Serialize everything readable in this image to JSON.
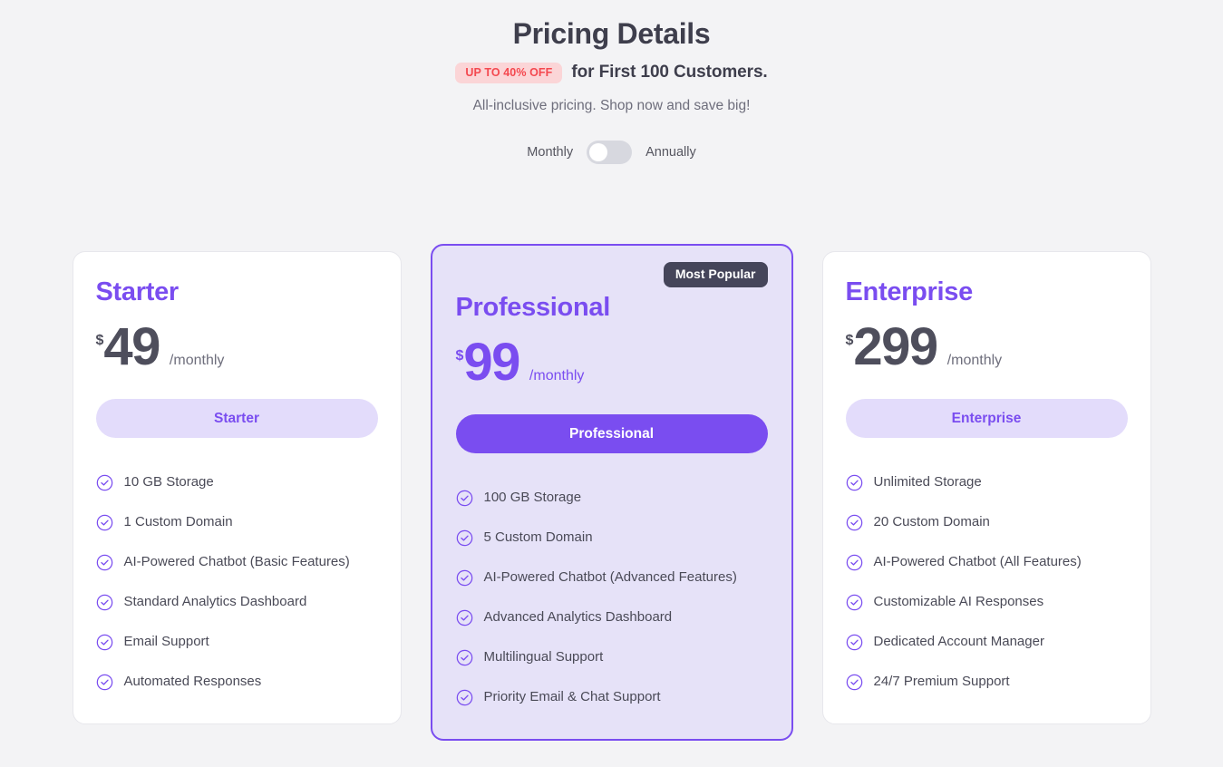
{
  "header": {
    "title": "Pricing Details",
    "discount_badge": "UP TO 40% OFF",
    "subtitle": "for First 100 Customers.",
    "tagline": "All-inclusive pricing. Shop now and save big!"
  },
  "billing_toggle": {
    "left_label": "Monthly",
    "right_label": "Annually",
    "selected": "Monthly",
    "state": "off"
  },
  "colors": {
    "accent": "#7a4df0",
    "accent_soft": "#e3dcfb",
    "featured_bg": "#e6e2f8",
    "badge_dark": "#45455a",
    "discount_bg": "#fbd5d7",
    "discount_text": "#f4484f",
    "page_bg": "#f3f3f5",
    "price_text": "#4e4e5c"
  },
  "icons": {
    "check": "check-circle-icon"
  },
  "plans": [
    {
      "name": "Starter",
      "currency": "$",
      "amount": "49",
      "period": "/monthly",
      "cta_label": "Starter",
      "featured": false,
      "badge": null,
      "features": [
        "10 GB Storage",
        "1 Custom Domain",
        "AI-Powered Chatbot (Basic Features)",
        "Standard Analytics Dashboard",
        "Email Support",
        "Automated Responses"
      ]
    },
    {
      "name": "Professional",
      "currency": "$",
      "amount": "99",
      "period": "/monthly",
      "cta_label": "Professional",
      "featured": true,
      "badge": "Most Popular",
      "features": [
        "100 GB Storage",
        "5 Custom Domain",
        "AI-Powered Chatbot (Advanced Features)",
        "Advanced Analytics Dashboard",
        "Multilingual Support",
        "Priority Email & Chat Support"
      ]
    },
    {
      "name": "Enterprise",
      "currency": "$",
      "amount": "299",
      "period": "/monthly",
      "cta_label": "Enterprise",
      "featured": false,
      "badge": null,
      "features": [
        "Unlimited Storage",
        "20 Custom Domain",
        "AI-Powered Chatbot (All Features)",
        "Customizable AI Responses",
        "Dedicated Account Manager",
        "24/7 Premium Support"
      ]
    }
  ]
}
